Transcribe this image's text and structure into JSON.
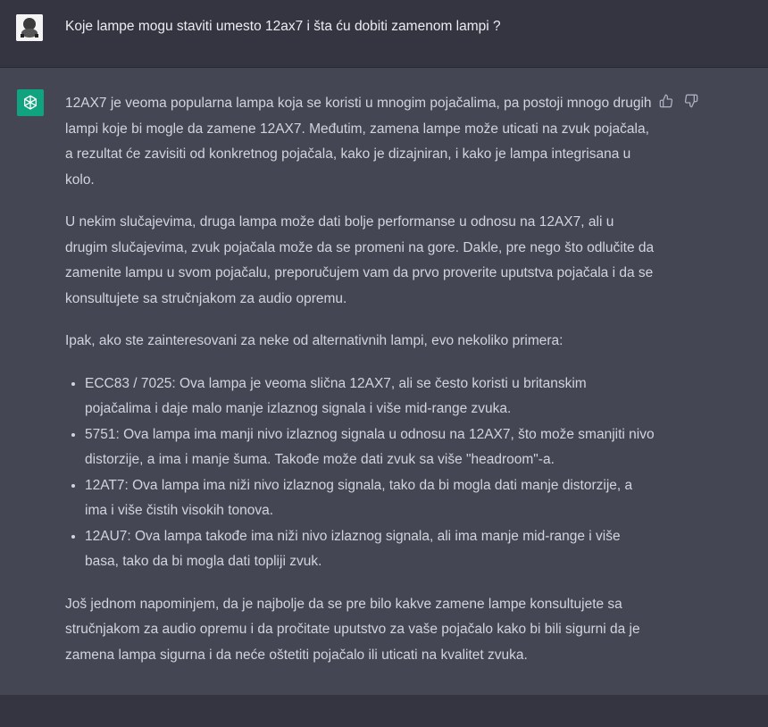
{
  "user_message": {
    "text": "Koje lampe mogu staviti umesto 12ax7 i šta ću dobiti zamenom lampi ?",
    "avatar_icon": "user-photo-avatar"
  },
  "assistant_message": {
    "avatar_icon": "openai-logo-icon",
    "avatar_color": "#10a37f",
    "paragraphs": [
      "12AX7 je veoma popularna lampa koja se koristi u mnogim pojačalima, pa postoji mnogo drugih lampi koje bi mogle da zamene 12AX7. Međutim, zamena lampe može uticati na zvuk pojačala, a rezultat će zavisiti od konkretnog pojačala, kako je dizajniran, i kako je lampa integrisana u kolo.",
      "U nekim slučajevima, druga lampa može dati bolje performanse u odnosu na 12AX7, ali u drugim slučajevima, zvuk pojačala može da se promeni na gore. Dakle, pre nego što odlučite da zamenite lampu u svom pojačalu, preporučujem vam da prvo proverite uputstva pojačala i da se konsultujete sa stručnjakom za audio opremu.",
      "Ipak, ako ste zainteresovani za neke od alternativnih lampi, evo nekoliko primera:"
    ],
    "list_items": [
      "ECC83 / 7025: Ova lampa je veoma slična 12AX7, ali se često koristi u britanskim pojačalima i daje malo manje izlaznog signala i više mid-range zvuka.",
      "5751: Ova lampa ima manji nivo izlaznog signala u odnosu na 12AX7, što može smanjiti nivo distorzije, a ima i manje šuma. Takođe može dati zvuk sa više \"headroom\"-a.",
      "12AT7: Ova lampa ima niži nivo izlaznog signala, tako da bi mogla dati manje distorzije, a ima i više čistih visokih tonova.",
      "12AU7: Ova lampa takođe ima niži nivo izlaznog signala, ali ima manje mid-range i više basa, tako da bi mogla dati topliji zvuk."
    ],
    "closing": "Još jednom napominjem, da je najbolje da se pre bilo kakve zamene lampe konsultujete sa stručnjakom za audio opremu i da pročitate uputstvo za vaše pojačalo kako bi bili sigurni da je zamena lampa sigurna i da neće oštetiti pojačalo ili uticati na kvalitet zvuka."
  },
  "feedback": {
    "like_icon": "thumbs-up-icon",
    "dislike_icon": "thumbs-down-icon"
  },
  "colors": {
    "page_bg": "#343541",
    "assistant_bg": "#444654",
    "text": "#d1d5db",
    "user_text": "#ececf1"
  }
}
